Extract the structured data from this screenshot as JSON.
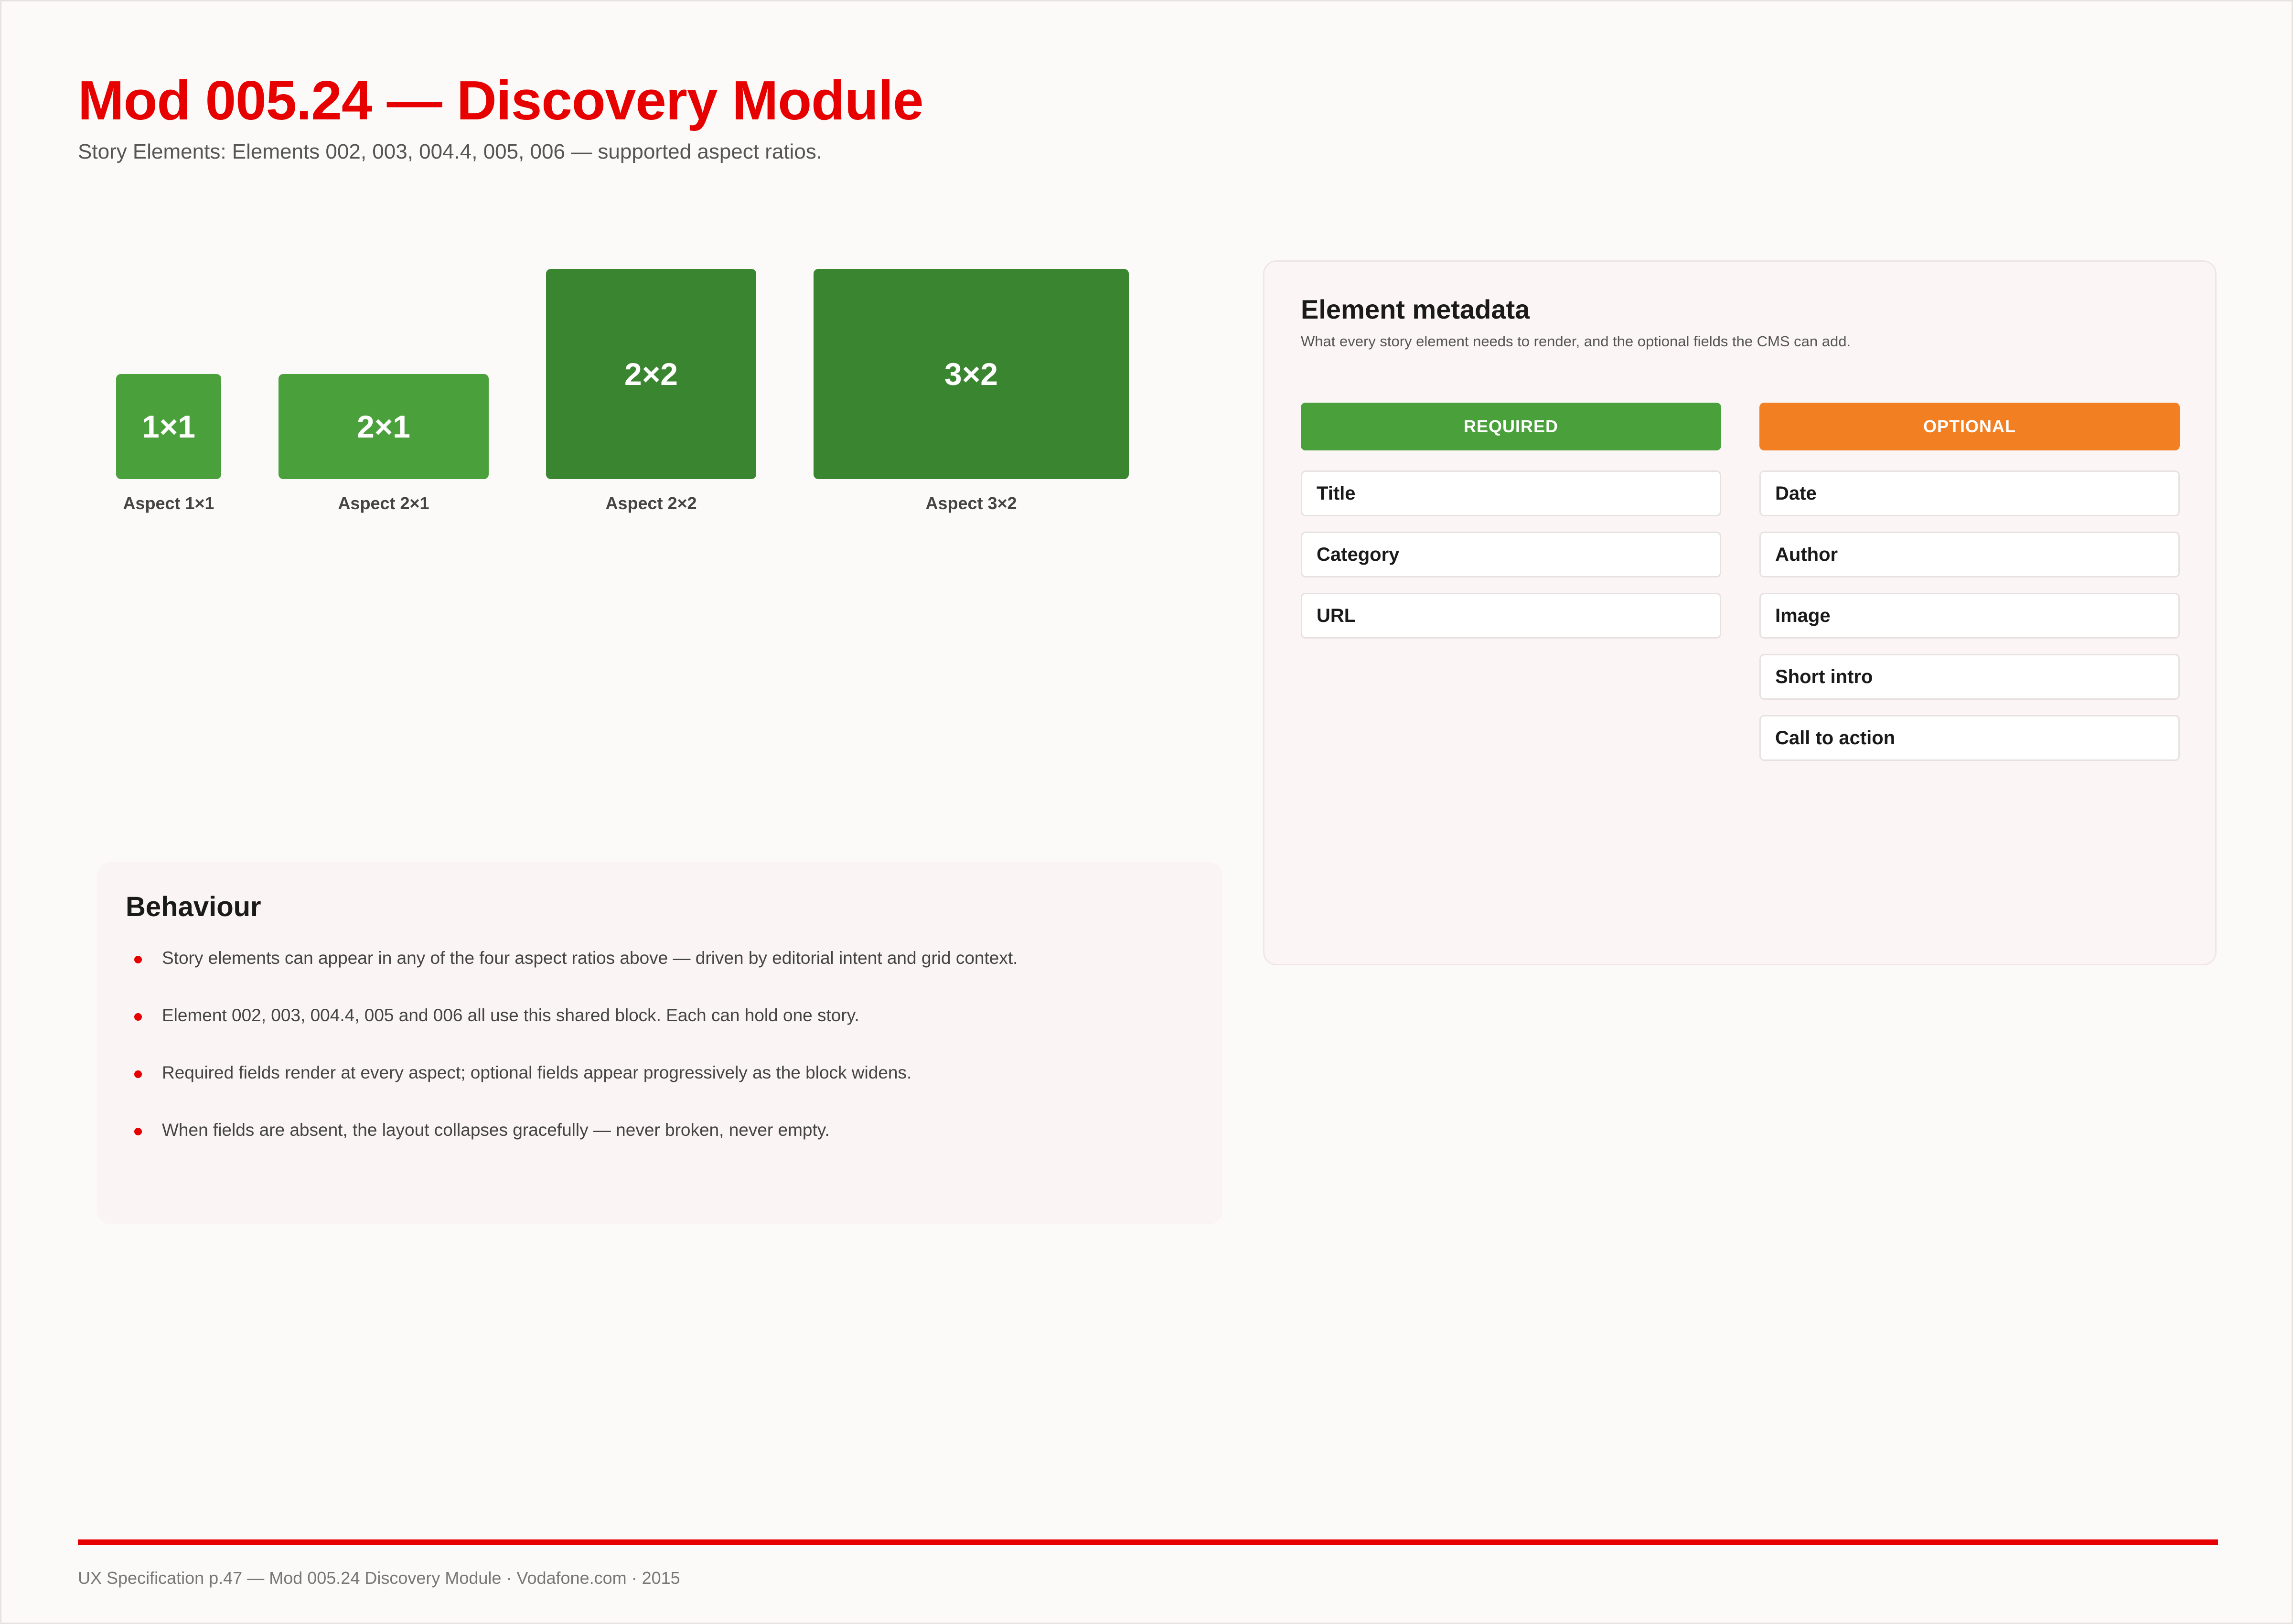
{
  "header": {
    "title": "Mod 005.24 — Discovery Module",
    "subtitle": "Story Elements: Elements 002, 003, 004.4, 005, 006 — supported aspect ratios."
  },
  "aspects": [
    {
      "block_label": "1×1",
      "caption": "Aspect 1×1"
    },
    {
      "block_label": "2×1",
      "caption": "Aspect 2×1"
    },
    {
      "block_label": "2×2",
      "caption": "Aspect 2×2"
    },
    {
      "block_label": "3×2",
      "caption": "Aspect 3×2"
    }
  ],
  "metadata": {
    "title": "Element metadata",
    "description": "What every story element needs to render, and the optional fields the CMS can add.",
    "required": {
      "header": "REQUIRED",
      "fields": [
        "Title",
        "Category",
        "URL"
      ]
    },
    "optional": {
      "header": "OPTIONAL",
      "fields": [
        "Date",
        "Author",
        "Image",
        "Short intro",
        "Call to action"
      ]
    }
  },
  "behaviour": {
    "title": "Behaviour",
    "bullets": [
      "Story elements can appear in any of the four aspect ratios above — driven by editorial intent and grid context.",
      "Element 002, 003, 004.4, 005 and 006 all use this shared block. Each can hold one story.",
      "Required fields render at every aspect; optional fields appear progressively as the block widens.",
      "When fields are absent, the layout collapses gracefully — never broken, never empty."
    ]
  },
  "footer": {
    "text": "UX Specification p.47 — Mod 005.24 Discovery Module · Vodafone.com · 2015"
  },
  "colors": {
    "brand_red": "#e60000",
    "green_light": "#4aa03a",
    "green_dark": "#3a8530",
    "orange": "#f28022"
  }
}
